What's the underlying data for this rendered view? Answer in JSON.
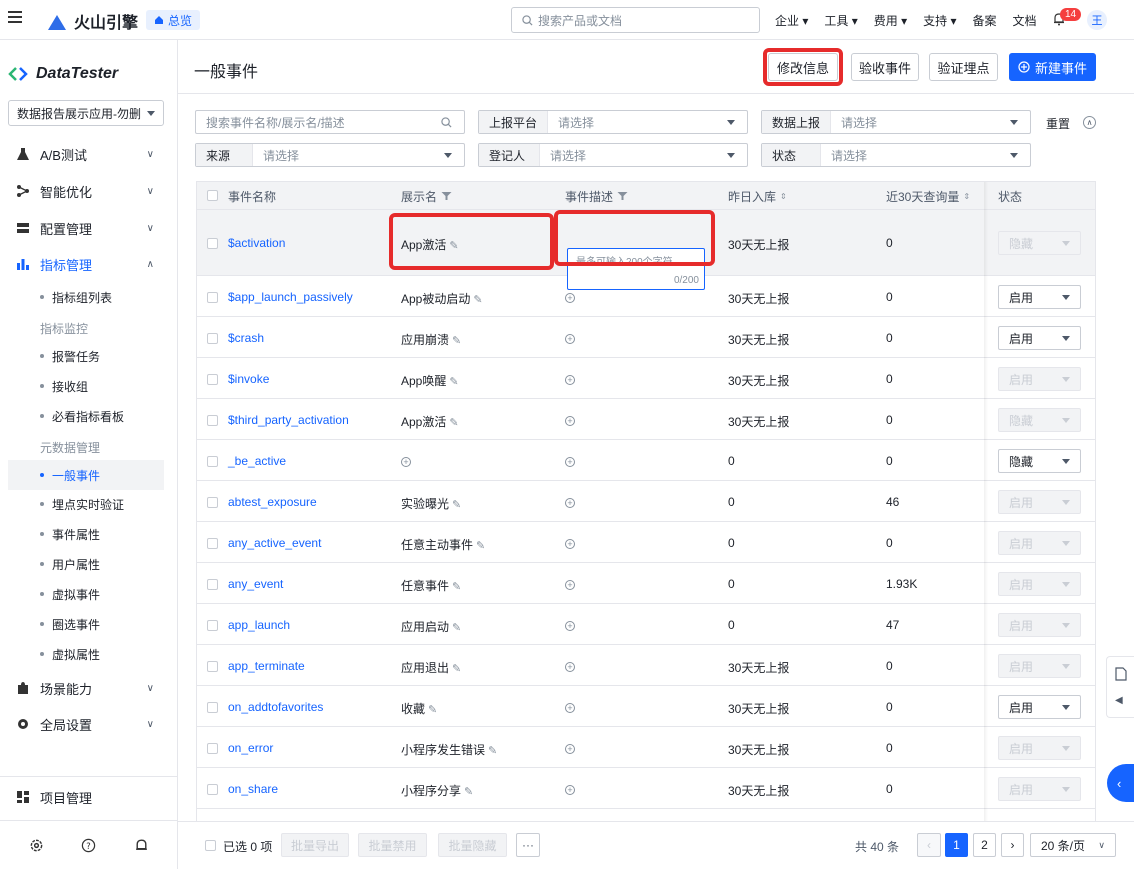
{
  "topbar": {
    "brand": "火山引擎",
    "home_label": "总览",
    "search_placeholder": "搜索产品或文档",
    "nav": [
      "企业",
      "工具",
      "费用",
      "支持",
      "备案",
      "文档"
    ],
    "notification_count": "14",
    "avatar_initial": "王"
  },
  "sidebar": {
    "product_name": "DataTester",
    "app_selector": "数据报告展示应用-勿删",
    "sections": {
      "ab_test": "A/B测试",
      "smart": "智能优化",
      "config": "配置管理",
      "metrics": "指标管理",
      "scene": "场景能力",
      "global": "全局设置"
    },
    "sub": {
      "metric_group_list": "指标组列表",
      "metric_monitor": "指标监控",
      "alarm_task": "报警任务",
      "receive_group": "接收组",
      "must_see_board": "必看指标看板",
      "meta_mgmt": "元数据管理",
      "general_events": "一般事件",
      "realtime_verify": "埋点实时验证",
      "event_props": "事件属性",
      "user_props": "用户属性",
      "virtual_events": "虚拟事件",
      "circle_events": "圈选事件",
      "virtual_props": "虚拟属性"
    },
    "project_mgmt": "项目管理"
  },
  "main": {
    "title": "一般事件",
    "btn_edit": "修改信息",
    "btn_accept": "验收事件",
    "btn_verify": "验证埋点",
    "btn_new": "新建事件",
    "filters": {
      "search_placeholder": "搜索事件名称/展示名/描述",
      "platform_label": "上报平台",
      "data_report_label": "数据上报",
      "source_label": "来源",
      "register_label": "登记人",
      "status_label": "状态",
      "placeholder": "请选择",
      "reset": "重置"
    },
    "columns": {
      "name": "事件名称",
      "display": "展示名",
      "desc": "事件描述",
      "yesterday": "昨日入库",
      "query30": "近30天查询量",
      "status": "状态"
    },
    "textarea": {
      "placeholder": "最多可输入200个字符",
      "count": "0/200"
    },
    "rows": [
      {
        "name": "$activation",
        "display": "App激活",
        "yesterday": "30天无上报",
        "q": "0",
        "status": "隐藏",
        "enabled": false
      },
      {
        "name": "$app_launch_passively",
        "display": "App被动启动",
        "yesterday": "30天无上报",
        "q": "0",
        "status": "启用",
        "enabled": true
      },
      {
        "name": "$crash",
        "display": "应用崩溃",
        "yesterday": "30天无上报",
        "q": "0",
        "status": "启用",
        "enabled": true
      },
      {
        "name": "$invoke",
        "display": "App唤醒",
        "yesterday": "30天无上报",
        "q": "0",
        "status": "启用",
        "enabled": false
      },
      {
        "name": "$third_party_activation",
        "display": "App激活",
        "yesterday": "30天无上报",
        "q": "0",
        "status": "隐藏",
        "enabled": false
      },
      {
        "name": "_be_active",
        "display": "",
        "yesterday": "0",
        "q": "0",
        "status": "隐藏",
        "enabled": true
      },
      {
        "name": "abtest_exposure",
        "display": "实验曝光",
        "yesterday": "0",
        "q": "46",
        "status": "启用",
        "enabled": false
      },
      {
        "name": "any_active_event",
        "display": "任意主动事件",
        "yesterday": "0",
        "q": "0",
        "status": "启用",
        "enabled": false
      },
      {
        "name": "any_event",
        "display": "任意事件",
        "yesterday": "0",
        "q": "1.93K",
        "status": "启用",
        "enabled": false
      },
      {
        "name": "app_launch",
        "display": "应用启动",
        "yesterday": "0",
        "q": "47",
        "status": "启用",
        "enabled": false
      },
      {
        "name": "app_terminate",
        "display": "应用退出",
        "yesterday": "30天无上报",
        "q": "0",
        "status": "启用",
        "enabled": false
      },
      {
        "name": "on_addtofavorites",
        "display": "收藏",
        "yesterday": "30天无上报",
        "q": "0",
        "status": "启用",
        "enabled": true
      },
      {
        "name": "on_error",
        "display": "小程序发生错误",
        "yesterday": "30天无上报",
        "q": "0",
        "status": "启用",
        "enabled": false
      },
      {
        "name": "on_share",
        "display": "小程序分享",
        "yesterday": "30天无上报",
        "q": "0",
        "status": "启用",
        "enabled": false
      }
    ],
    "footer": {
      "selected": "已选 0 项",
      "export": "批量导出",
      "disable": "批量禁用",
      "hide": "批量隐藏",
      "more": "···",
      "total": "共 40 条",
      "page1": "1",
      "page2": "2",
      "page_size": "20 条/页"
    }
  }
}
